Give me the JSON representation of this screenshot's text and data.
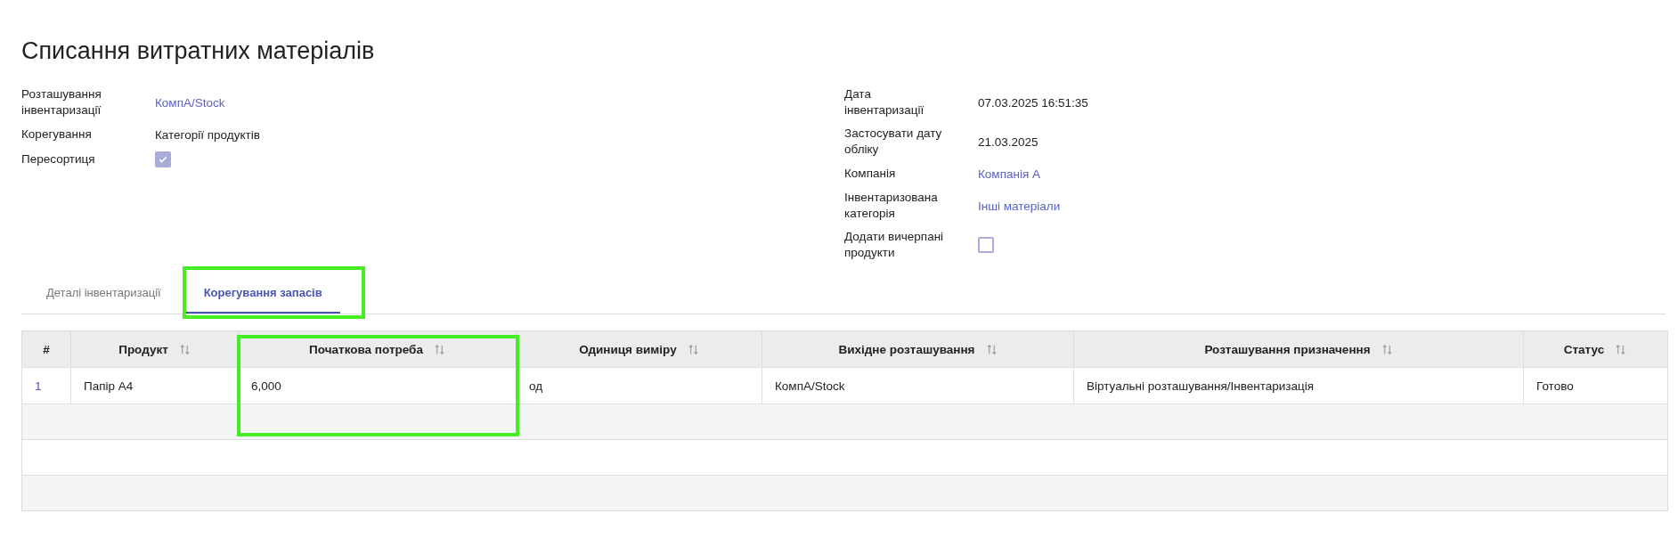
{
  "title": "Списання витратних матеріалів",
  "fields_left": [
    {
      "label": "Розташування\nінвентаризації",
      "kind": "link",
      "value": "КомпА/Stock"
    },
    {
      "label": "Корегування",
      "kind": "text",
      "value": "Категорії продуктів"
    },
    {
      "label": "Пересортиця",
      "kind": "checkbox",
      "checked": true
    }
  ],
  "fields_right": [
    {
      "label": "Дата\nінвентаризації",
      "kind": "text",
      "value": "07.03.2025 16:51:35"
    },
    {
      "label": "Застосувати дату\nобліку",
      "kind": "text",
      "value": "21.03.2025"
    },
    {
      "label": "Компанія",
      "kind": "link",
      "value": "Компанія А"
    },
    {
      "label": "Інвентаризована\nкатегорія",
      "kind": "link",
      "value": "Інші матеріали"
    },
    {
      "label": "Додати вичерпані\nпродукти",
      "kind": "checkbox",
      "checked": false
    }
  ],
  "tabs": [
    {
      "label": "Деталі інвентаризації",
      "selected": false,
      "highlighted": false
    },
    {
      "label": "Корегування запасів",
      "selected": true,
      "highlighted": true
    }
  ],
  "table": {
    "columns": [
      {
        "label": "#",
        "sortable": false,
        "highlighted": false
      },
      {
        "label": "Продукт",
        "sortable": true,
        "highlighted": false
      },
      {
        "label": "Початкова потреба",
        "sortable": true,
        "highlighted": true
      },
      {
        "label": "Одиниця виміру",
        "sortable": true,
        "highlighted": false
      },
      {
        "label": "Вихідне розташування",
        "sortable": true,
        "highlighted": false
      },
      {
        "label": "Розташування призначення",
        "sortable": true,
        "highlighted": false
      },
      {
        "label": "Статус",
        "sortable": true,
        "highlighted": false
      }
    ],
    "rows": [
      [
        "1",
        "Папір А4",
        "6,000",
        "од",
        "КомпА/Stock",
        "Віртуальні розташування/Інвентаризація",
        "Готово"
      ]
    ]
  }
}
